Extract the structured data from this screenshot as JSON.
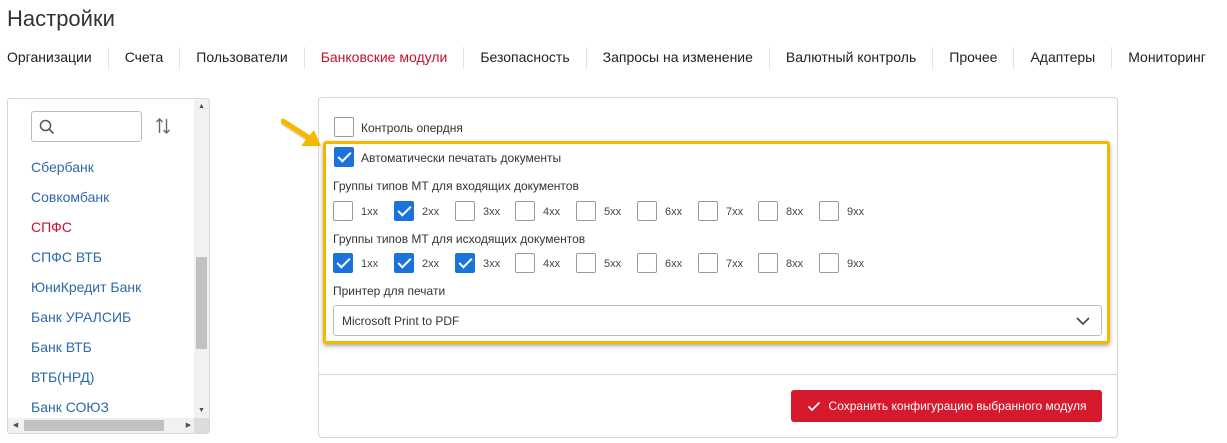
{
  "page": {
    "title": "Настройки"
  },
  "tabs": [
    {
      "label": "Организации",
      "active": false
    },
    {
      "label": "Счета",
      "active": false
    },
    {
      "label": "Пользователи",
      "active": false
    },
    {
      "label": "Банковские модули",
      "active": true
    },
    {
      "label": "Безопасность",
      "active": false
    },
    {
      "label": "Запросы на изменение",
      "active": false
    },
    {
      "label": "Валютный контроль",
      "active": false
    },
    {
      "label": "Прочее",
      "active": false
    },
    {
      "label": "Адаптеры",
      "active": false
    },
    {
      "label": "Мониторинг",
      "active": false
    }
  ],
  "sidebar": {
    "search": {
      "value": "",
      "placeholder": ""
    },
    "banks": [
      {
        "label": "Сбербанк",
        "active": false
      },
      {
        "label": "Совкомбанк",
        "active": false
      },
      {
        "label": "СПФС",
        "active": true
      },
      {
        "label": "СПФС ВТБ",
        "active": false
      },
      {
        "label": "ЮниКредит Банк",
        "active": false
      },
      {
        "label": "Банк УРАЛСИБ",
        "active": false
      },
      {
        "label": "Банк ВТБ",
        "active": false
      },
      {
        "label": "ВТБ(НРД)",
        "active": false
      },
      {
        "label": "Банк СОЮЗ",
        "active": false
      }
    ]
  },
  "config": {
    "control_operday": {
      "label": "Контроль опердня",
      "checked": false
    },
    "auto_print": {
      "label": "Автоматически печатать документы",
      "checked": true
    },
    "incoming": {
      "title": "Группы типов МТ для входящих документов",
      "groups": [
        {
          "label": "1xx",
          "checked": false
        },
        {
          "label": "2xx",
          "checked": true
        },
        {
          "label": "3xx",
          "checked": false
        },
        {
          "label": "4xx",
          "checked": false
        },
        {
          "label": "5xx",
          "checked": false
        },
        {
          "label": "6xx",
          "checked": false
        },
        {
          "label": "7xx",
          "checked": false
        },
        {
          "label": "8xx",
          "checked": false
        },
        {
          "label": "9xx",
          "checked": false
        }
      ]
    },
    "outgoing": {
      "title": "Группы типов МТ для исходящих документов",
      "groups": [
        {
          "label": "1xx",
          "checked": true
        },
        {
          "label": "2xx",
          "checked": true
        },
        {
          "label": "3xx",
          "checked": true
        },
        {
          "label": "4xx",
          "checked": false
        },
        {
          "label": "5xx",
          "checked": false
        },
        {
          "label": "6xx",
          "checked": false
        },
        {
          "label": "7xx",
          "checked": false
        },
        {
          "label": "8xx",
          "checked": false
        },
        {
          "label": "9xx",
          "checked": false
        }
      ]
    },
    "printer": {
      "title": "Принтер для печати",
      "selected": "Microsoft Print to PDF"
    },
    "save_label": "Сохранить конфигурацию выбранного модуля"
  },
  "colors": {
    "accent": "#c8102e",
    "link": "#2e6aa8",
    "checkbox": "#1a73d9",
    "highlight": "#f5b800",
    "button": "#d7192d"
  },
  "icons": [
    "search-icon",
    "sort-icon",
    "chevron-down-icon",
    "check-icon",
    "arrow-pointer-icon"
  ]
}
